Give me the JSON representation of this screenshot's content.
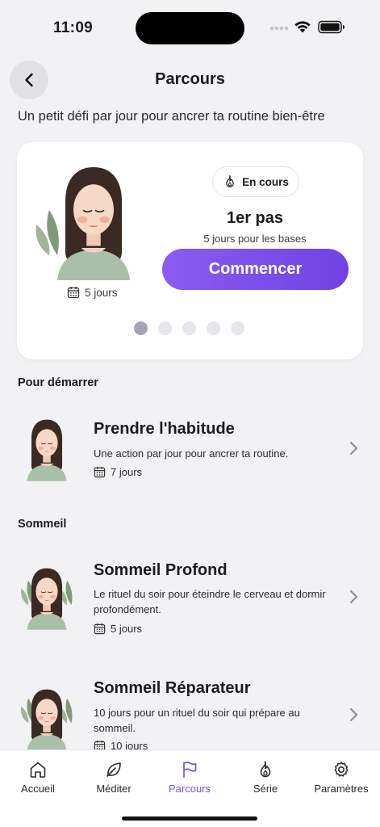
{
  "status_bar": {
    "time": "11:09",
    "icons": [
      "cellular-signal-icon",
      "wifi-icon",
      "battery-icon"
    ]
  },
  "header": {
    "title": "Parcours",
    "subtitle": "Un petit défi par jour pour ancrer ta routine bien-être",
    "back_icon": "chevron-left-icon"
  },
  "featured": {
    "status_label": "En cours",
    "status_icon": "flame-icon",
    "title": "1er pas",
    "description": "5 jours pour les bases",
    "cta_label": "Commencer",
    "duration": "5 jours",
    "dots_count": 5,
    "active_dot": 0
  },
  "sections": [
    {
      "title": "Pour démarrer"
    },
    {
      "title": "Sommeil"
    }
  ],
  "programs": [
    {
      "title": "Prendre l'habitude",
      "description": "Une action par jour pour ancrer ta routine.",
      "duration": "7 jours"
    },
    {
      "title": "Sommeil Profond",
      "description": "Le rituel du soir pour éteindre le cerveau et dormir profondément.",
      "duration": "5 jours"
    },
    {
      "title": "Sommeil Réparateur",
      "description": "10 jours pour un rituel du soir qui prépare au sommeil.",
      "duration": "10 jours"
    }
  ],
  "tabs": [
    {
      "label": "Accueil",
      "icon": "home-icon",
      "active": false
    },
    {
      "label": "Méditer",
      "icon": "leaf-icon",
      "active": false
    },
    {
      "label": "Parcours",
      "icon": "flag-icon",
      "active": true
    },
    {
      "label": "Série",
      "icon": "flame-icon",
      "active": false
    },
    {
      "label": "Paramètres",
      "icon": "gear-icon",
      "active": false
    }
  ],
  "colors": {
    "accent": "#7a4fe6",
    "cta_gradient_start": "#8a5cf0",
    "cta_gradient_end": "#7042e4",
    "background": "#f2f2f4",
    "card": "#ffffff",
    "hair": "#3a2a22",
    "skin": "#f6d8c6",
    "shirt": "#a9bfa8",
    "leaf": "#7f9a78"
  }
}
